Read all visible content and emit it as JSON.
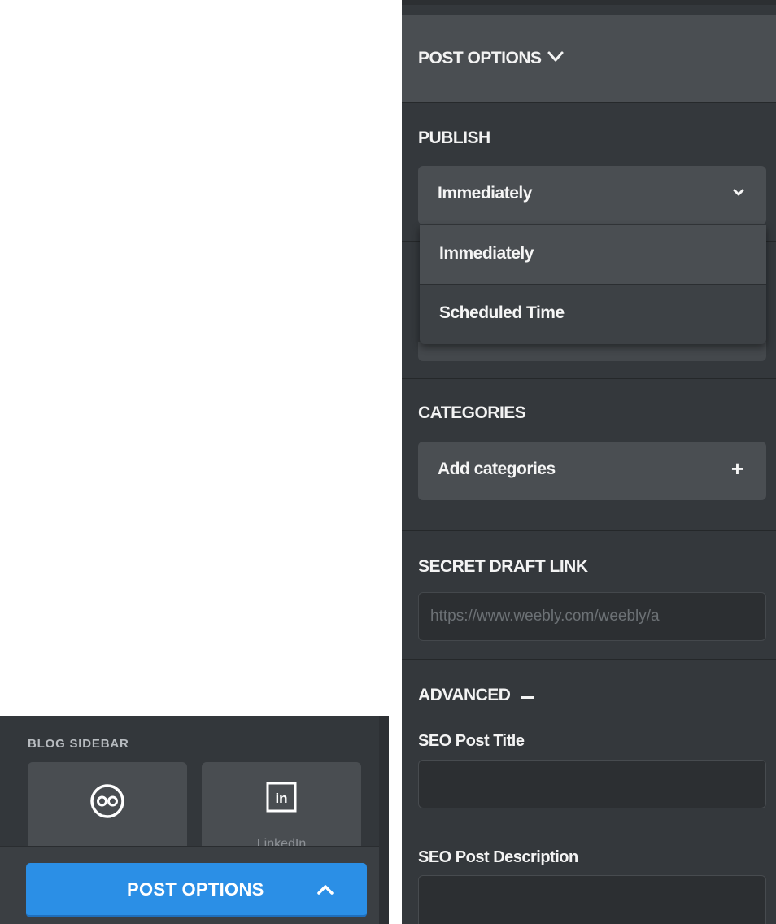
{
  "panel": {
    "header_title": "POST OPTIONS",
    "publish": {
      "label": "PUBLISH",
      "selected": "Immediately",
      "options": [
        "Immediately",
        "Scheduled Time"
      ]
    },
    "categories": {
      "label": "CATEGORIES",
      "add_label": "Add categories",
      "add_glyph": "+"
    },
    "secret_draft": {
      "label": "SECRET DRAFT LINK",
      "value": "https://www.weebly.com/weebly/a"
    },
    "advanced": {
      "label": "ADVANCED",
      "seo_title_label": "SEO Post Title",
      "seo_title_value": "",
      "seo_description_label": "SEO Post Description",
      "seo_description_value": ""
    }
  },
  "widget": {
    "title": "BLOG SIDEBAR",
    "tiles": [
      {
        "label": "",
        "icon": "flickr-icon"
      },
      {
        "label": "LinkedIn",
        "icon": "linkedin-icon",
        "icon_text": "in"
      }
    ],
    "button_label": "POST OPTIONS"
  },
  "colors": {
    "panel_bg": "#34383c",
    "header_bg": "#4a4e52",
    "primary_button": "#2b8fe6"
  }
}
